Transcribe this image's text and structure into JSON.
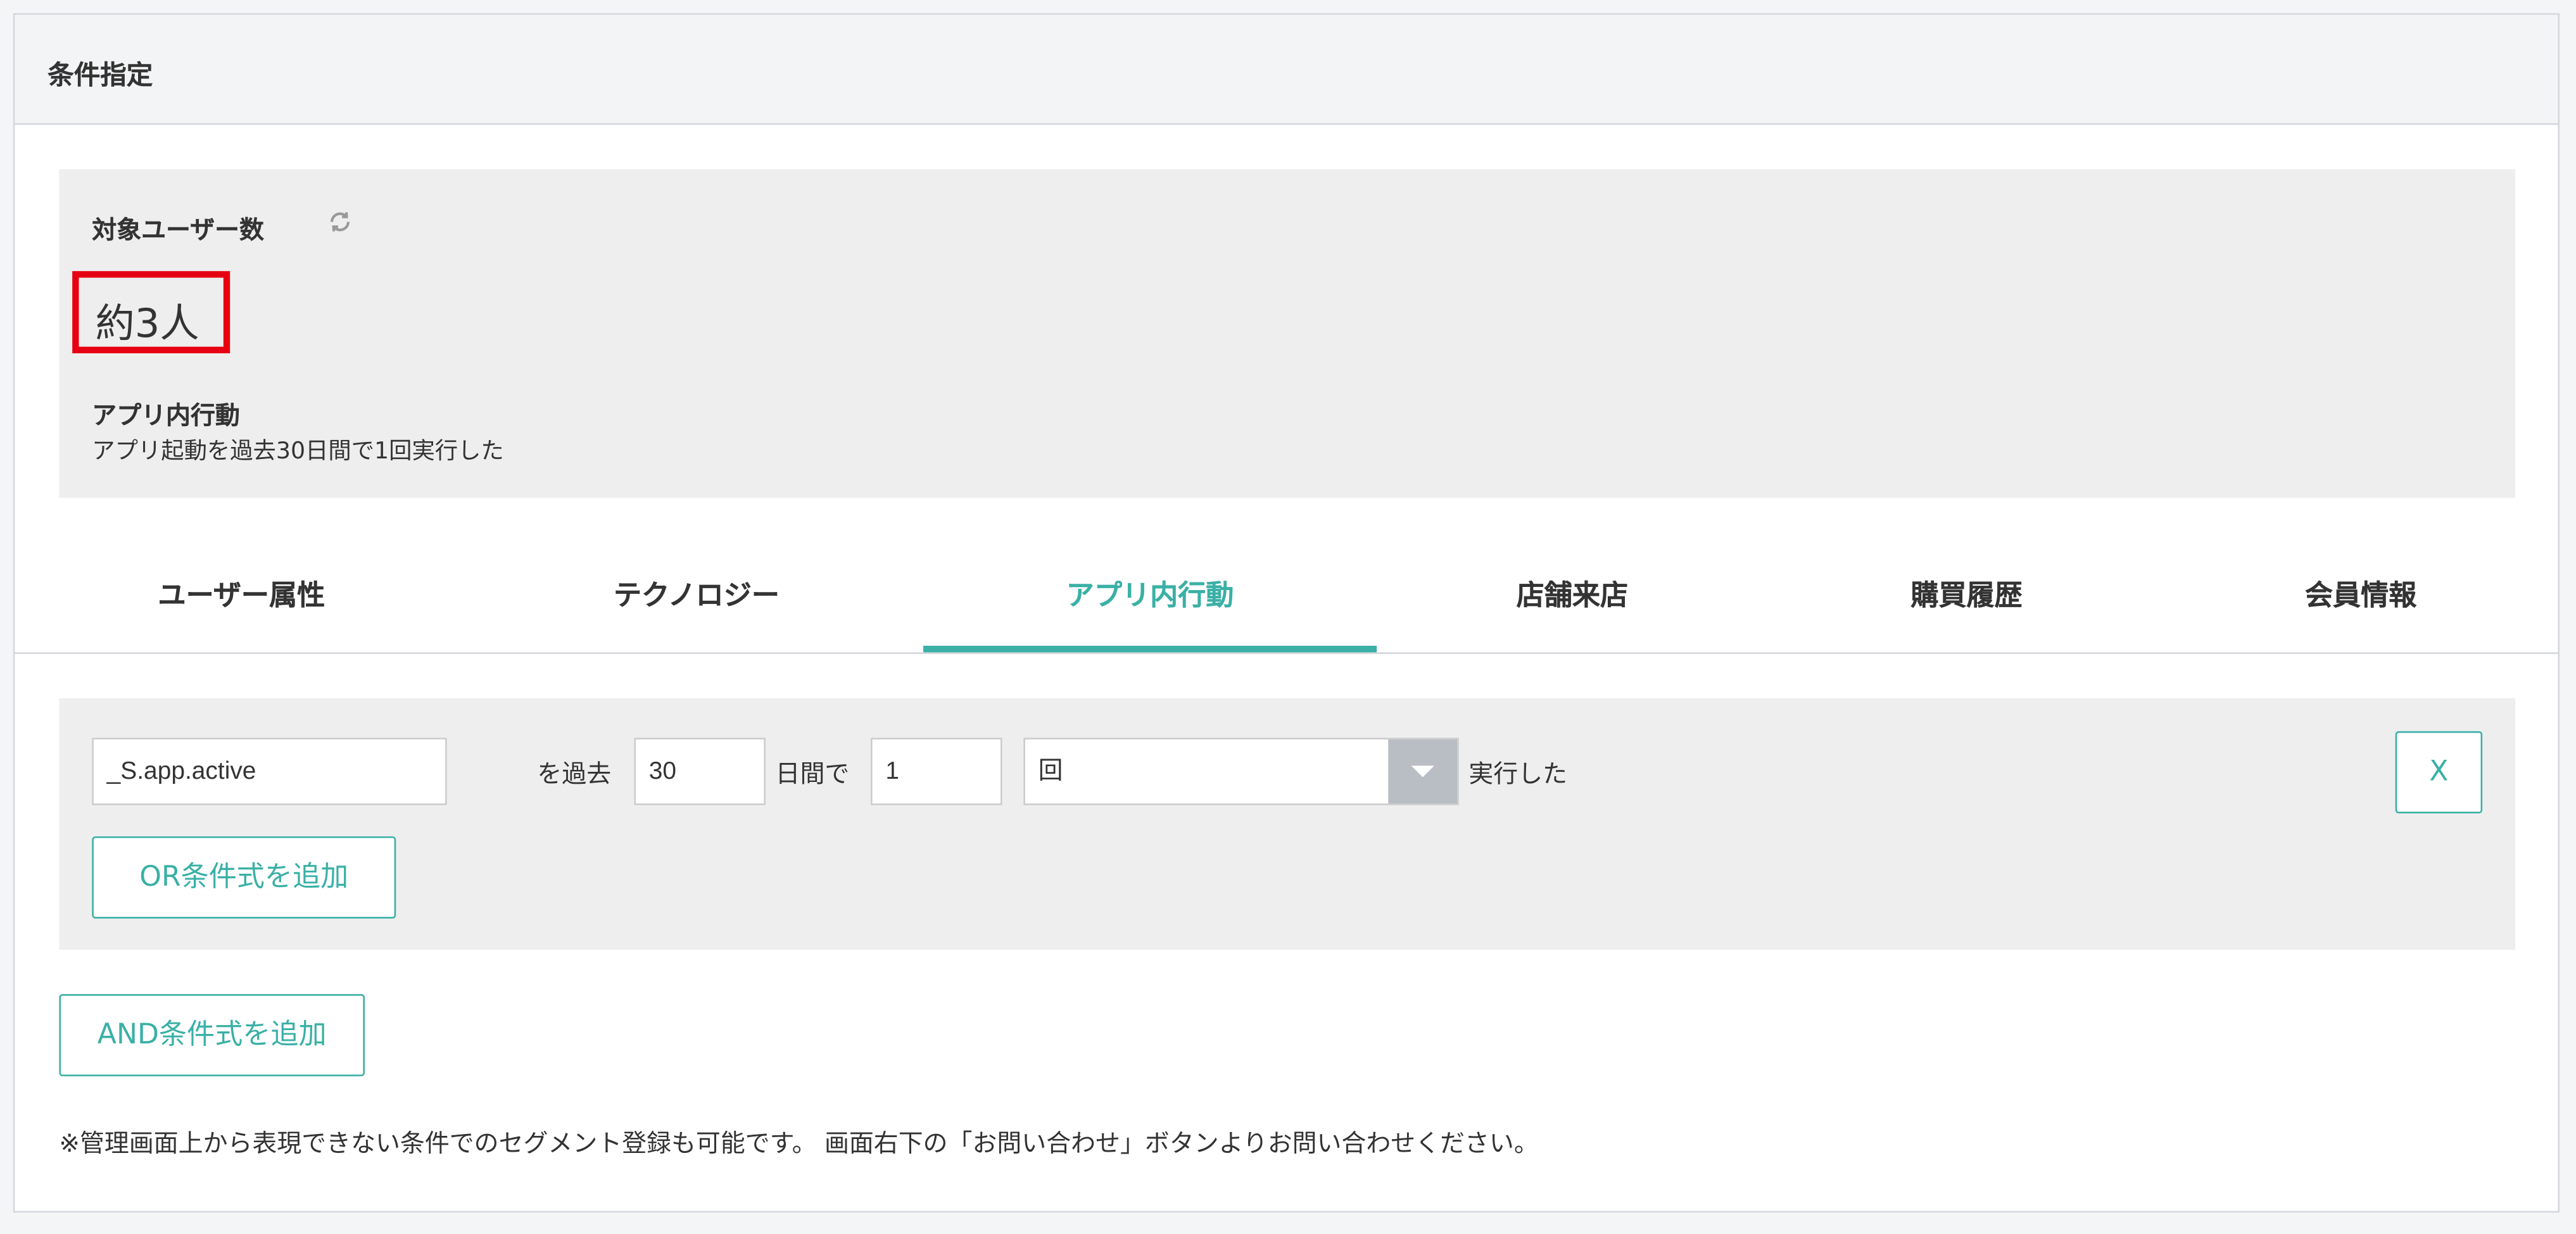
{
  "panel": {
    "title": "条件指定"
  },
  "summary": {
    "label": "対象ユーザー数",
    "refresh_icon": "refresh-icon",
    "count": "約3人",
    "condition_title": "アプリ内行動",
    "condition_text": "アプリ起動を過去30日間で1回実行した"
  },
  "tabs": [
    {
      "label": "ユーザー属性",
      "active": false
    },
    {
      "label": "テクノロジー",
      "active": false
    },
    {
      "label": "アプリ内行動",
      "active": true
    },
    {
      "label": "店舗来店",
      "active": false
    },
    {
      "label": "購買履歴",
      "active": false
    },
    {
      "label": "会員情報",
      "active": false
    }
  ],
  "condition": {
    "event_value": "_S.app.active",
    "past_label": "を過去",
    "days_value": "30",
    "days_label": "日間で",
    "count_value": "1",
    "unit_selected": "回",
    "executed_label": "実行した",
    "remove_label": "X",
    "add_or_label": "OR条件式を追加"
  },
  "add_and_label": "AND条件式を追加",
  "note": "※管理画面上から表現できない条件でのセグメント登録も可能です。 画面右下の「お問い合わせ」ボタンよりお問い合わせください。",
  "colors": {
    "accent": "#3ab0a6",
    "highlight": "#e60012",
    "panel_bg": "#eeeeee"
  }
}
